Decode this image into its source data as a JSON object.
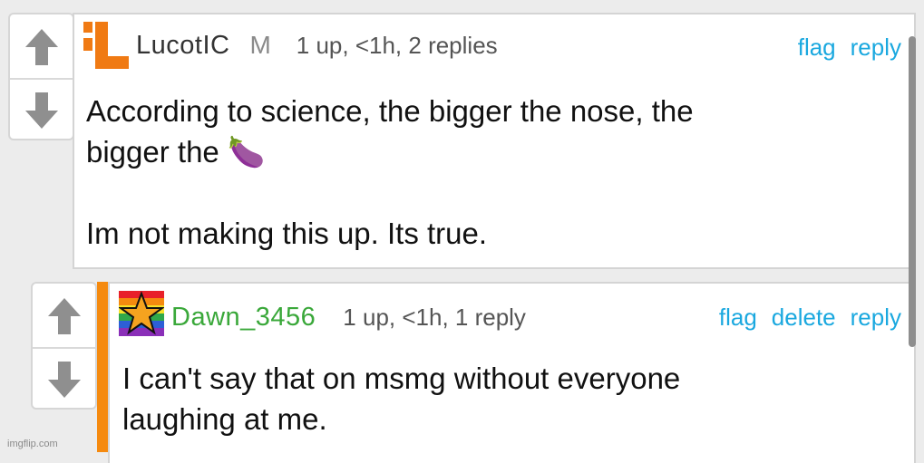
{
  "comments": [
    {
      "username": "LucotIC",
      "badge": "M",
      "meta": "1 up, <1h, 2 replies",
      "actions": [
        "flag",
        "reply"
      ],
      "body": "According to science, the bigger the nose, the\nbigger the 🍆\n\nIm not making this up. Its true.",
      "username_color": "#333333",
      "avatar_color": "#f07a13"
    },
    {
      "username": "Dawn_3456",
      "meta": "1 up, <1h, 1 reply",
      "actions": [
        "flag",
        "delete",
        "reply"
      ],
      "body": "I can't say that on msmg without everyone\nlaughing at me.",
      "username_color": "#3aa83a",
      "thread_color": "#f58a0f"
    }
  ],
  "watermark": "imgflip.com"
}
